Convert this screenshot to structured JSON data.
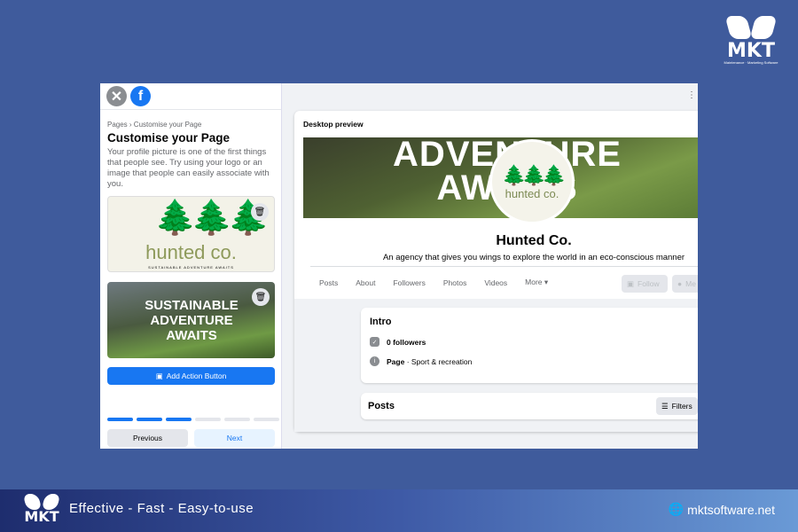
{
  "brand": {
    "logo_text": "MKT",
    "logo_sub": "Maintenance · Marketing Software",
    "tagline": "Effective - Fast - Easy-to-use",
    "website": "mktsoftware.net"
  },
  "sidebar": {
    "breadcrumb": "Pages › Customise your Page",
    "title": "Customise your Page",
    "description": "Your profile picture is one of the first things that people see. Try using your logo or an image that people can easily associate with you.",
    "profile_logo_text": "hunted co.",
    "profile_logo_sub": "SUSTAINABLE ADVENTURE AWAITS",
    "cover_text": "SUSTAINABLE ADVENTURE AWAITS",
    "action_button": "Add Action Button",
    "progress": {
      "steps": 6,
      "completed": 3
    },
    "prev": "Previous",
    "next": "Next"
  },
  "preview": {
    "label": "Desktop preview",
    "cover_text": "ADVENTURE AWAITS",
    "avatar_text": "hunted co.",
    "page_name": "Hunted Co.",
    "tagline": "An agency that gives you wings to explore the world in an eco-conscious manner",
    "tabs": [
      "Posts",
      "About",
      "Followers",
      "Photos",
      "Videos",
      "More ▾"
    ],
    "follow": "Follow",
    "message": "Me",
    "intro": {
      "title": "Intro",
      "followers": "0 followers",
      "page_bold": "Page",
      "page_cat": " · Sport & recreation"
    },
    "posts": "Posts",
    "filters": "Filters"
  }
}
